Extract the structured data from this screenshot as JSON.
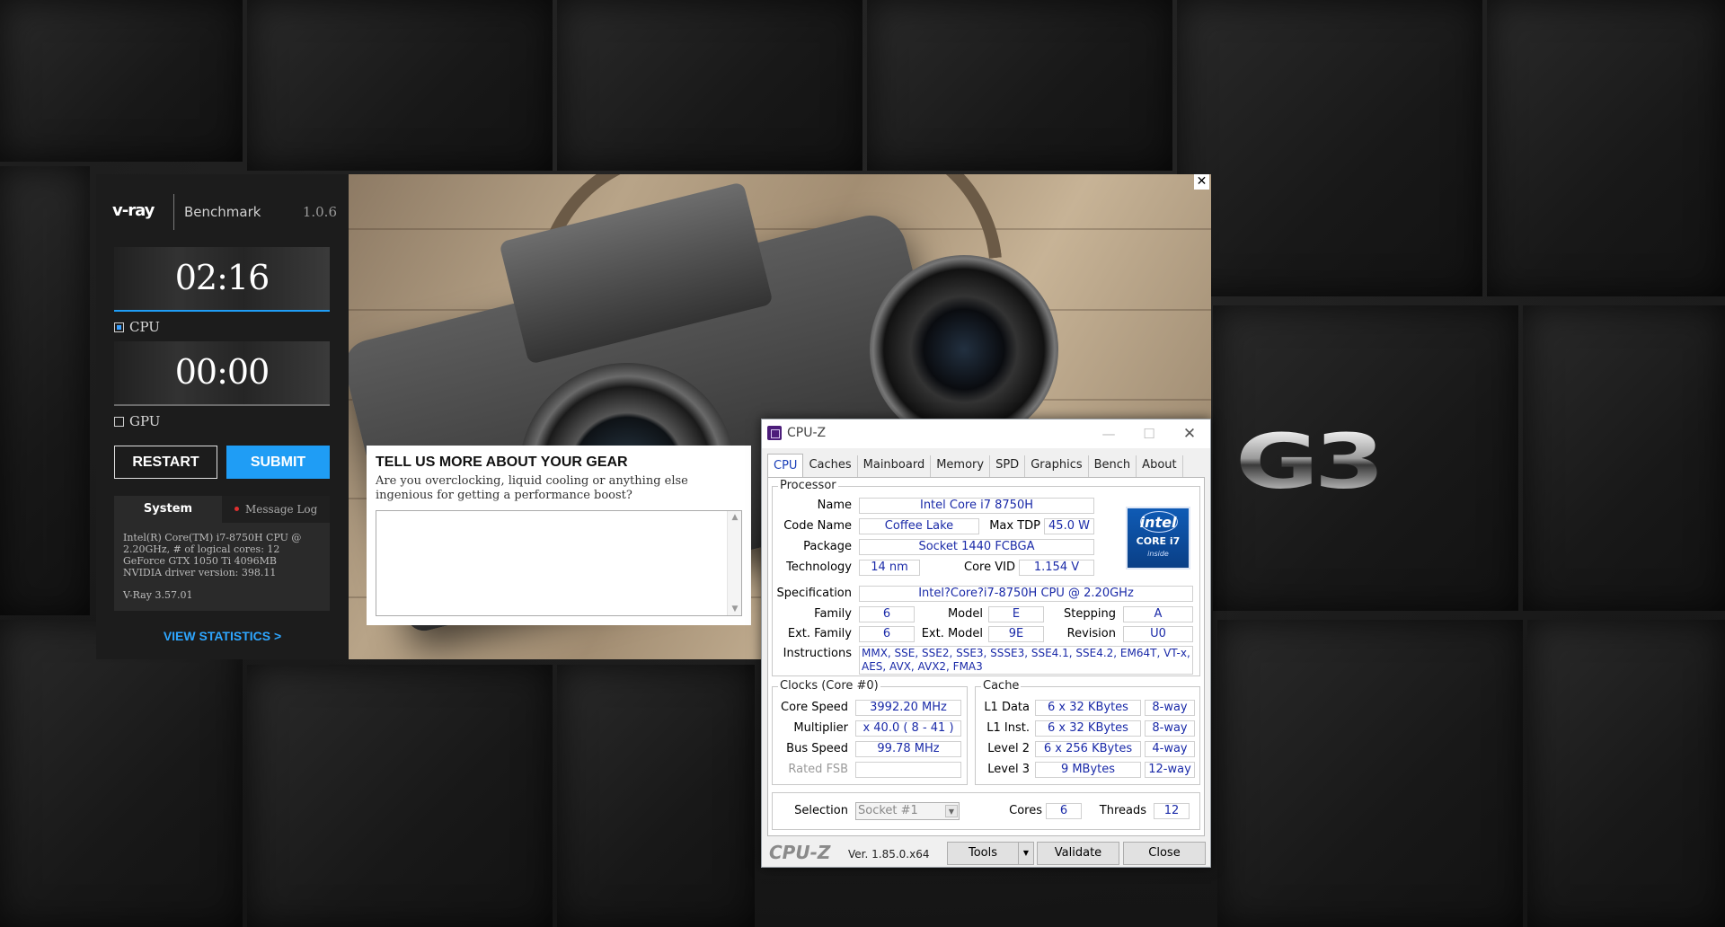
{
  "desktop": {
    "logo_text": "G3"
  },
  "vray": {
    "logo": "v-ray",
    "product": "Benchmark",
    "version": "1.0.6",
    "cpu_timer": "02:16",
    "gpu_timer": "00:00",
    "cpu_label": "CPU",
    "gpu_label": "GPU",
    "cpu_checked": true,
    "gpu_checked": false,
    "restart_label": "RESTART",
    "submit_label": "SUBMIT",
    "tab_system": "System",
    "tab_log": "Message Log",
    "system_info": {
      "line1": "Intel(R) Core(TM) i7-8750H CPU @",
      "line2": "2.20GHz, # of logical cores: 12",
      "line3": "GeForce GTX 1050 Ti 4096MB",
      "line4": "NVIDIA driver version: 398.11",
      "line5": "V-Ray 3.57.01"
    },
    "view_statistics": "VIEW STATISTICS >",
    "accent_color": "#1f9df5"
  },
  "feedback": {
    "close_glyph": "✕",
    "title": "TELL US MORE ABOUT YOUR GEAR",
    "description": "Are you overclocking, liquid cooling or anything else ingenious for getting a performance boost?",
    "input_value": ""
  },
  "cpuz": {
    "title": "CPU-Z",
    "tabs": [
      "CPU",
      "Caches",
      "Mainboard",
      "Memory",
      "SPD",
      "Graphics",
      "Bench",
      "About"
    ],
    "active_tab": "CPU",
    "processor": {
      "group_title": "Processor",
      "name_label": "Name",
      "name": "Intel Core i7 8750H",
      "codename_label": "Code Name",
      "codename": "Coffee Lake",
      "maxtdp_label": "Max TDP",
      "maxtdp": "45.0 W",
      "package_label": "Package",
      "package": "Socket 1440 FCBGA",
      "technology_label": "Technology",
      "technology": "14 nm",
      "corevid_label": "Core VID",
      "corevid": "1.154 V",
      "spec_label": "Specification",
      "spec": "Intel?Core?i7-8750H CPU @ 2.20GHz",
      "family_label": "Family",
      "family": "6",
      "model_label": "Model",
      "model": "E",
      "stepping_label": "Stepping",
      "stepping": "A",
      "extfamily_label": "Ext. Family",
      "extfamily": "6",
      "extmodel_label": "Ext. Model",
      "extmodel": "9E",
      "revision_label": "Revision",
      "revision": "U0",
      "instructions_label": "Instructions",
      "instructions_line1": "MMX, SSE, SSE2, SSE3, SSSE3, SSE4.1, SSE4.2, EM64T, VT-x,",
      "instructions_line2": "AES, AVX, AVX2, FMA3"
    },
    "intel_badge": {
      "brand": "intel",
      "line": "CORE i7",
      "inside": "inside"
    },
    "clocks": {
      "group_title": "Clocks (Core #0)",
      "corespeed_label": "Core Speed",
      "corespeed": "3992.20 MHz",
      "multiplier_label": "Multiplier",
      "multiplier": "x 40.0 ( 8 - 41 )",
      "busspeed_label": "Bus Speed",
      "busspeed": "99.78 MHz",
      "ratedfsb_label": "Rated FSB",
      "ratedfsb": ""
    },
    "cache": {
      "group_title": "Cache",
      "l1data_label": "L1 Data",
      "l1data": "6 x 32 KBytes",
      "l1data_way": "8-way",
      "l1inst_label": "L1 Inst.",
      "l1inst": "6 x 32 KBytes",
      "l1inst_way": "8-way",
      "l2_label": "Level 2",
      "l2": "6 x 256 KBytes",
      "l2_way": "4-way",
      "l3_label": "Level 3",
      "l3": "9 MBytes",
      "l3_way": "12-way"
    },
    "selection": {
      "label": "Selection",
      "value": "Socket #1",
      "cores_label": "Cores",
      "cores": "6",
      "threads_label": "Threads",
      "threads": "12"
    },
    "footer": {
      "brand": "CPU-Z",
      "version": "Ver. 1.85.0.x64",
      "tools": "Tools",
      "validate": "Validate",
      "close": "Close"
    }
  }
}
